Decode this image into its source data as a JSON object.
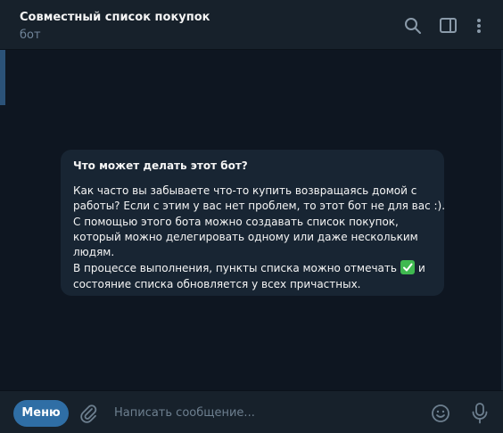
{
  "header": {
    "title": "Совместный список покупок",
    "subtitle": "бот"
  },
  "bot_info": {
    "title": "Что может делать этот бот?",
    "lines": [
      "Как часто вы забываете что-то купить возвращаясь домой с",
      "работы? Если с этим у вас нет проблем, то этот бот не для вас :).",
      "С помощью этого бота можно создавать список покупок,",
      "который можно делегировать одному или даже нескольким",
      "людям.",
      "В процессе выполнения, пункты списка можно отмечать",
      "и",
      "состояние списка обновляется у всех причастных."
    ]
  },
  "composer": {
    "menu_label": "Меню",
    "placeholder": "Написать сообщение..."
  },
  "icons": {
    "search": "search-icon",
    "sidebar": "sidebar-toggle-icon",
    "more": "more-vertical-icon",
    "attach": "paperclip-icon",
    "emoji": "emoji-icon",
    "mic": "microphone-icon",
    "check": "check-mark-icon"
  },
  "colors": {
    "background": "#0e1621",
    "panel": "#17212b",
    "card": "#182533",
    "accent": "#2f6ea5",
    "muted_text": "#708499",
    "check_green": "#3fb950"
  }
}
